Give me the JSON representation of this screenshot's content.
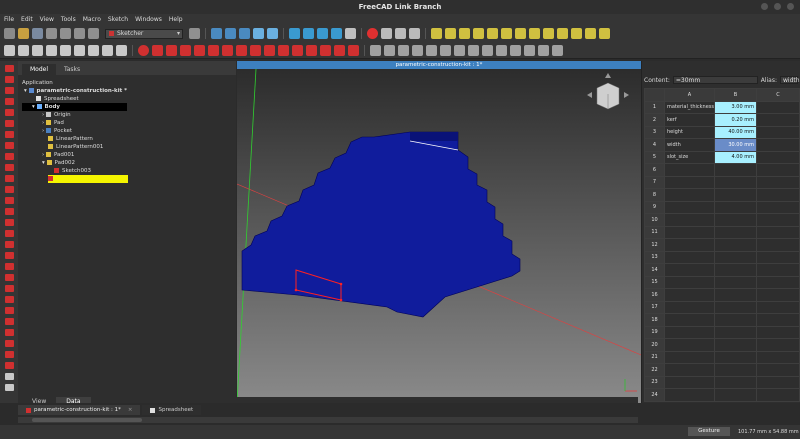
{
  "window": {
    "title": "FreeCAD Link Branch"
  },
  "menu": [
    "File",
    "Edit",
    "View",
    "Tools",
    "Macro",
    "Sketch",
    "Windows",
    "Help"
  ],
  "toolbar": {
    "workbench": "Sketcher"
  },
  "combo_view": {
    "tabs": [
      "Model",
      "Tasks"
    ],
    "section_label": "Application",
    "tree": [
      {
        "label": "parametric-construction-kit *",
        "icon": "document-icon"
      },
      {
        "label": "Spreadsheet",
        "icon": "spreadsheet-icon"
      },
      {
        "label": "Body",
        "icon": "body-icon"
      },
      {
        "label": "Origin",
        "icon": "origin-icon"
      },
      {
        "label": "Pad",
        "icon": "pad-icon"
      },
      {
        "label": "Pocket",
        "icon": "pocket-icon"
      },
      {
        "label": "LinearPattern",
        "icon": "linear-pattern-icon"
      },
      {
        "label": "LinearPattern001",
        "icon": "linear-pattern-icon"
      },
      {
        "label": "Pad001",
        "icon": "pad-icon"
      },
      {
        "label": "Pad002",
        "icon": "pad-icon"
      },
      {
        "label": "Sketch003",
        "icon": "sketch-icon"
      }
    ],
    "bottom_tabs": [
      "View",
      "Data"
    ]
  },
  "view3d": {
    "title": "parametric-construction-kit : 1*"
  },
  "spreadsheet": {
    "content_label": "Content:",
    "content_value": "=30mm",
    "alias_label": "Alias:",
    "alias_value": "width",
    "columns": [
      "A",
      "B",
      "C"
    ],
    "rows": [
      {
        "n": "1",
        "a": "material_thickness",
        "b": "3.00 mm"
      },
      {
        "n": "2",
        "a": "kerf",
        "b": "0.20 mm"
      },
      {
        "n": "3",
        "a": "height",
        "b": "40.00 mm"
      },
      {
        "n": "4",
        "a": "width",
        "b": "30.00 mm"
      },
      {
        "n": "5",
        "a": "slot_size",
        "b": "4.00 mm"
      },
      {
        "n": "6"
      },
      {
        "n": "7"
      },
      {
        "n": "8"
      },
      {
        "n": "9"
      },
      {
        "n": "10"
      },
      {
        "n": "11"
      },
      {
        "n": "12"
      },
      {
        "n": "13"
      },
      {
        "n": "14"
      },
      {
        "n": "15"
      },
      {
        "n": "16"
      },
      {
        "n": "17"
      },
      {
        "n": "18"
      },
      {
        "n": "19"
      },
      {
        "n": "20"
      },
      {
        "n": "21"
      },
      {
        "n": "22"
      },
      {
        "n": "23"
      },
      {
        "n": "24"
      }
    ]
  },
  "doc_tabs": [
    "parametric-construction-kit : 1*",
    "Spreadsheet"
  ],
  "status": {
    "nav_style": "Gesture",
    "dimensions": "101.77 mm x 54.88 mm"
  }
}
